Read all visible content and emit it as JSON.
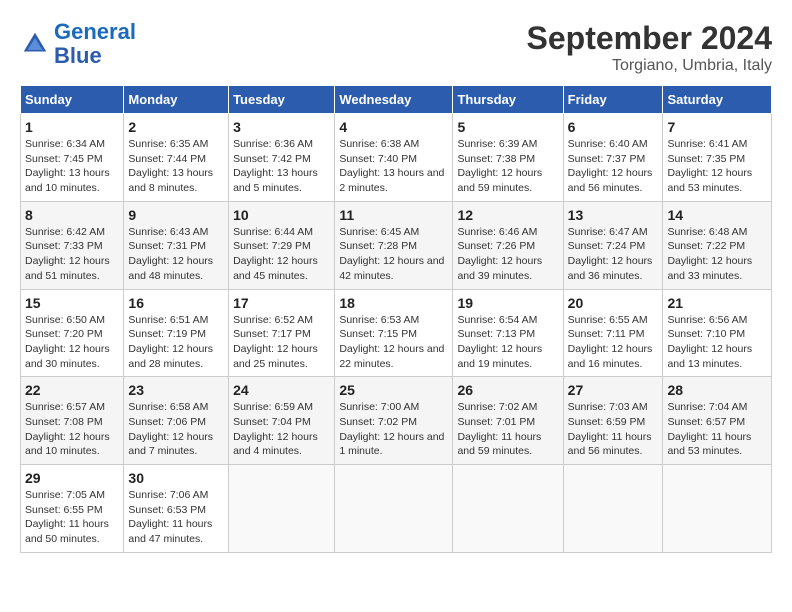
{
  "header": {
    "logo_line1": "General",
    "logo_line2": "Blue",
    "title": "September 2024",
    "subtitle": "Torgiano, Umbria, Italy"
  },
  "calendar": {
    "columns": [
      "Sunday",
      "Monday",
      "Tuesday",
      "Wednesday",
      "Thursday",
      "Friday",
      "Saturday"
    ],
    "rows": [
      [
        {
          "day": "1",
          "info": "Sunrise: 6:34 AM\nSunset: 7:45 PM\nDaylight: 13 hours and 10 minutes."
        },
        {
          "day": "2",
          "info": "Sunrise: 6:35 AM\nSunset: 7:44 PM\nDaylight: 13 hours and 8 minutes."
        },
        {
          "day": "3",
          "info": "Sunrise: 6:36 AM\nSunset: 7:42 PM\nDaylight: 13 hours and 5 minutes."
        },
        {
          "day": "4",
          "info": "Sunrise: 6:38 AM\nSunset: 7:40 PM\nDaylight: 13 hours and 2 minutes."
        },
        {
          "day": "5",
          "info": "Sunrise: 6:39 AM\nSunset: 7:38 PM\nDaylight: 12 hours and 59 minutes."
        },
        {
          "day": "6",
          "info": "Sunrise: 6:40 AM\nSunset: 7:37 PM\nDaylight: 12 hours and 56 minutes."
        },
        {
          "day": "7",
          "info": "Sunrise: 6:41 AM\nSunset: 7:35 PM\nDaylight: 12 hours and 53 minutes."
        }
      ],
      [
        {
          "day": "8",
          "info": "Sunrise: 6:42 AM\nSunset: 7:33 PM\nDaylight: 12 hours and 51 minutes."
        },
        {
          "day": "9",
          "info": "Sunrise: 6:43 AM\nSunset: 7:31 PM\nDaylight: 12 hours and 48 minutes."
        },
        {
          "day": "10",
          "info": "Sunrise: 6:44 AM\nSunset: 7:29 PM\nDaylight: 12 hours and 45 minutes."
        },
        {
          "day": "11",
          "info": "Sunrise: 6:45 AM\nSunset: 7:28 PM\nDaylight: 12 hours and 42 minutes."
        },
        {
          "day": "12",
          "info": "Sunrise: 6:46 AM\nSunset: 7:26 PM\nDaylight: 12 hours and 39 minutes."
        },
        {
          "day": "13",
          "info": "Sunrise: 6:47 AM\nSunset: 7:24 PM\nDaylight: 12 hours and 36 minutes."
        },
        {
          "day": "14",
          "info": "Sunrise: 6:48 AM\nSunset: 7:22 PM\nDaylight: 12 hours and 33 minutes."
        }
      ],
      [
        {
          "day": "15",
          "info": "Sunrise: 6:50 AM\nSunset: 7:20 PM\nDaylight: 12 hours and 30 minutes."
        },
        {
          "day": "16",
          "info": "Sunrise: 6:51 AM\nSunset: 7:19 PM\nDaylight: 12 hours and 28 minutes."
        },
        {
          "day": "17",
          "info": "Sunrise: 6:52 AM\nSunset: 7:17 PM\nDaylight: 12 hours and 25 minutes."
        },
        {
          "day": "18",
          "info": "Sunrise: 6:53 AM\nSunset: 7:15 PM\nDaylight: 12 hours and 22 minutes."
        },
        {
          "day": "19",
          "info": "Sunrise: 6:54 AM\nSunset: 7:13 PM\nDaylight: 12 hours and 19 minutes."
        },
        {
          "day": "20",
          "info": "Sunrise: 6:55 AM\nSunset: 7:11 PM\nDaylight: 12 hours and 16 minutes."
        },
        {
          "day": "21",
          "info": "Sunrise: 6:56 AM\nSunset: 7:10 PM\nDaylight: 12 hours and 13 minutes."
        }
      ],
      [
        {
          "day": "22",
          "info": "Sunrise: 6:57 AM\nSunset: 7:08 PM\nDaylight: 12 hours and 10 minutes."
        },
        {
          "day": "23",
          "info": "Sunrise: 6:58 AM\nSunset: 7:06 PM\nDaylight: 12 hours and 7 minutes."
        },
        {
          "day": "24",
          "info": "Sunrise: 6:59 AM\nSunset: 7:04 PM\nDaylight: 12 hours and 4 minutes."
        },
        {
          "day": "25",
          "info": "Sunrise: 7:00 AM\nSunset: 7:02 PM\nDaylight: 12 hours and 1 minute."
        },
        {
          "day": "26",
          "info": "Sunrise: 7:02 AM\nSunset: 7:01 PM\nDaylight: 11 hours and 59 minutes."
        },
        {
          "day": "27",
          "info": "Sunrise: 7:03 AM\nSunset: 6:59 PM\nDaylight: 11 hours and 56 minutes."
        },
        {
          "day": "28",
          "info": "Sunrise: 7:04 AM\nSunset: 6:57 PM\nDaylight: 11 hours and 53 minutes."
        }
      ],
      [
        {
          "day": "29",
          "info": "Sunrise: 7:05 AM\nSunset: 6:55 PM\nDaylight: 11 hours and 50 minutes."
        },
        {
          "day": "30",
          "info": "Sunrise: 7:06 AM\nSunset: 6:53 PM\nDaylight: 11 hours and 47 minutes."
        },
        {
          "day": "",
          "info": ""
        },
        {
          "day": "",
          "info": ""
        },
        {
          "day": "",
          "info": ""
        },
        {
          "day": "",
          "info": ""
        },
        {
          "day": "",
          "info": ""
        }
      ]
    ]
  }
}
